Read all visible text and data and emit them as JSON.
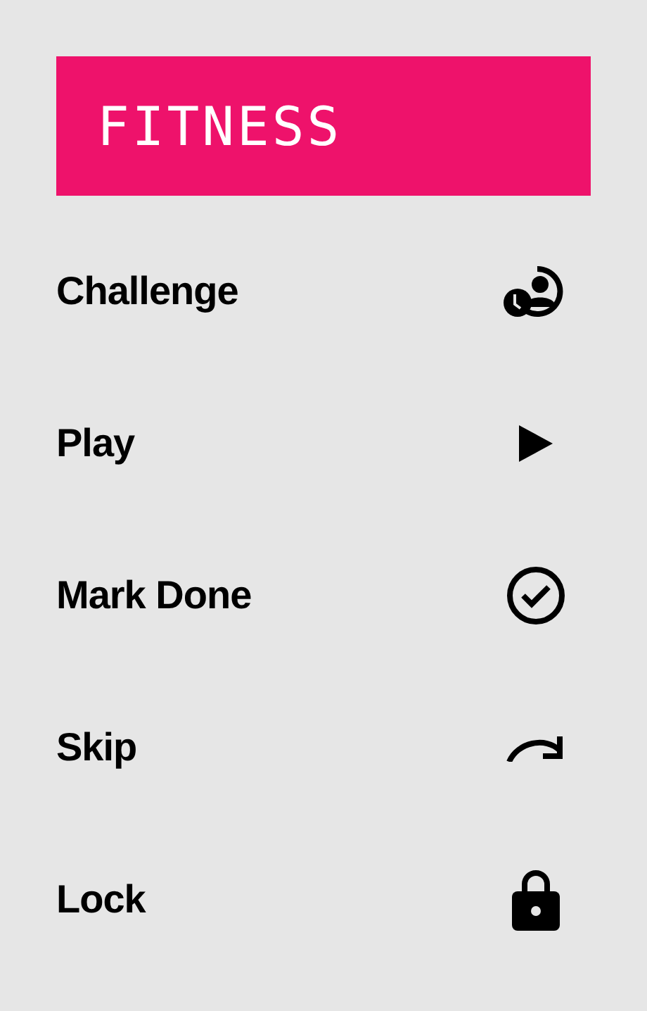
{
  "header": {
    "title": "FITNESS"
  },
  "menu": [
    {
      "label": "Challenge",
      "kind": "challenge"
    },
    {
      "label": "Play",
      "kind": "play"
    },
    {
      "label": "Mark Done",
      "kind": "done"
    },
    {
      "label": "Skip",
      "kind": "skip"
    },
    {
      "label": "Lock",
      "kind": "lock"
    }
  ]
}
